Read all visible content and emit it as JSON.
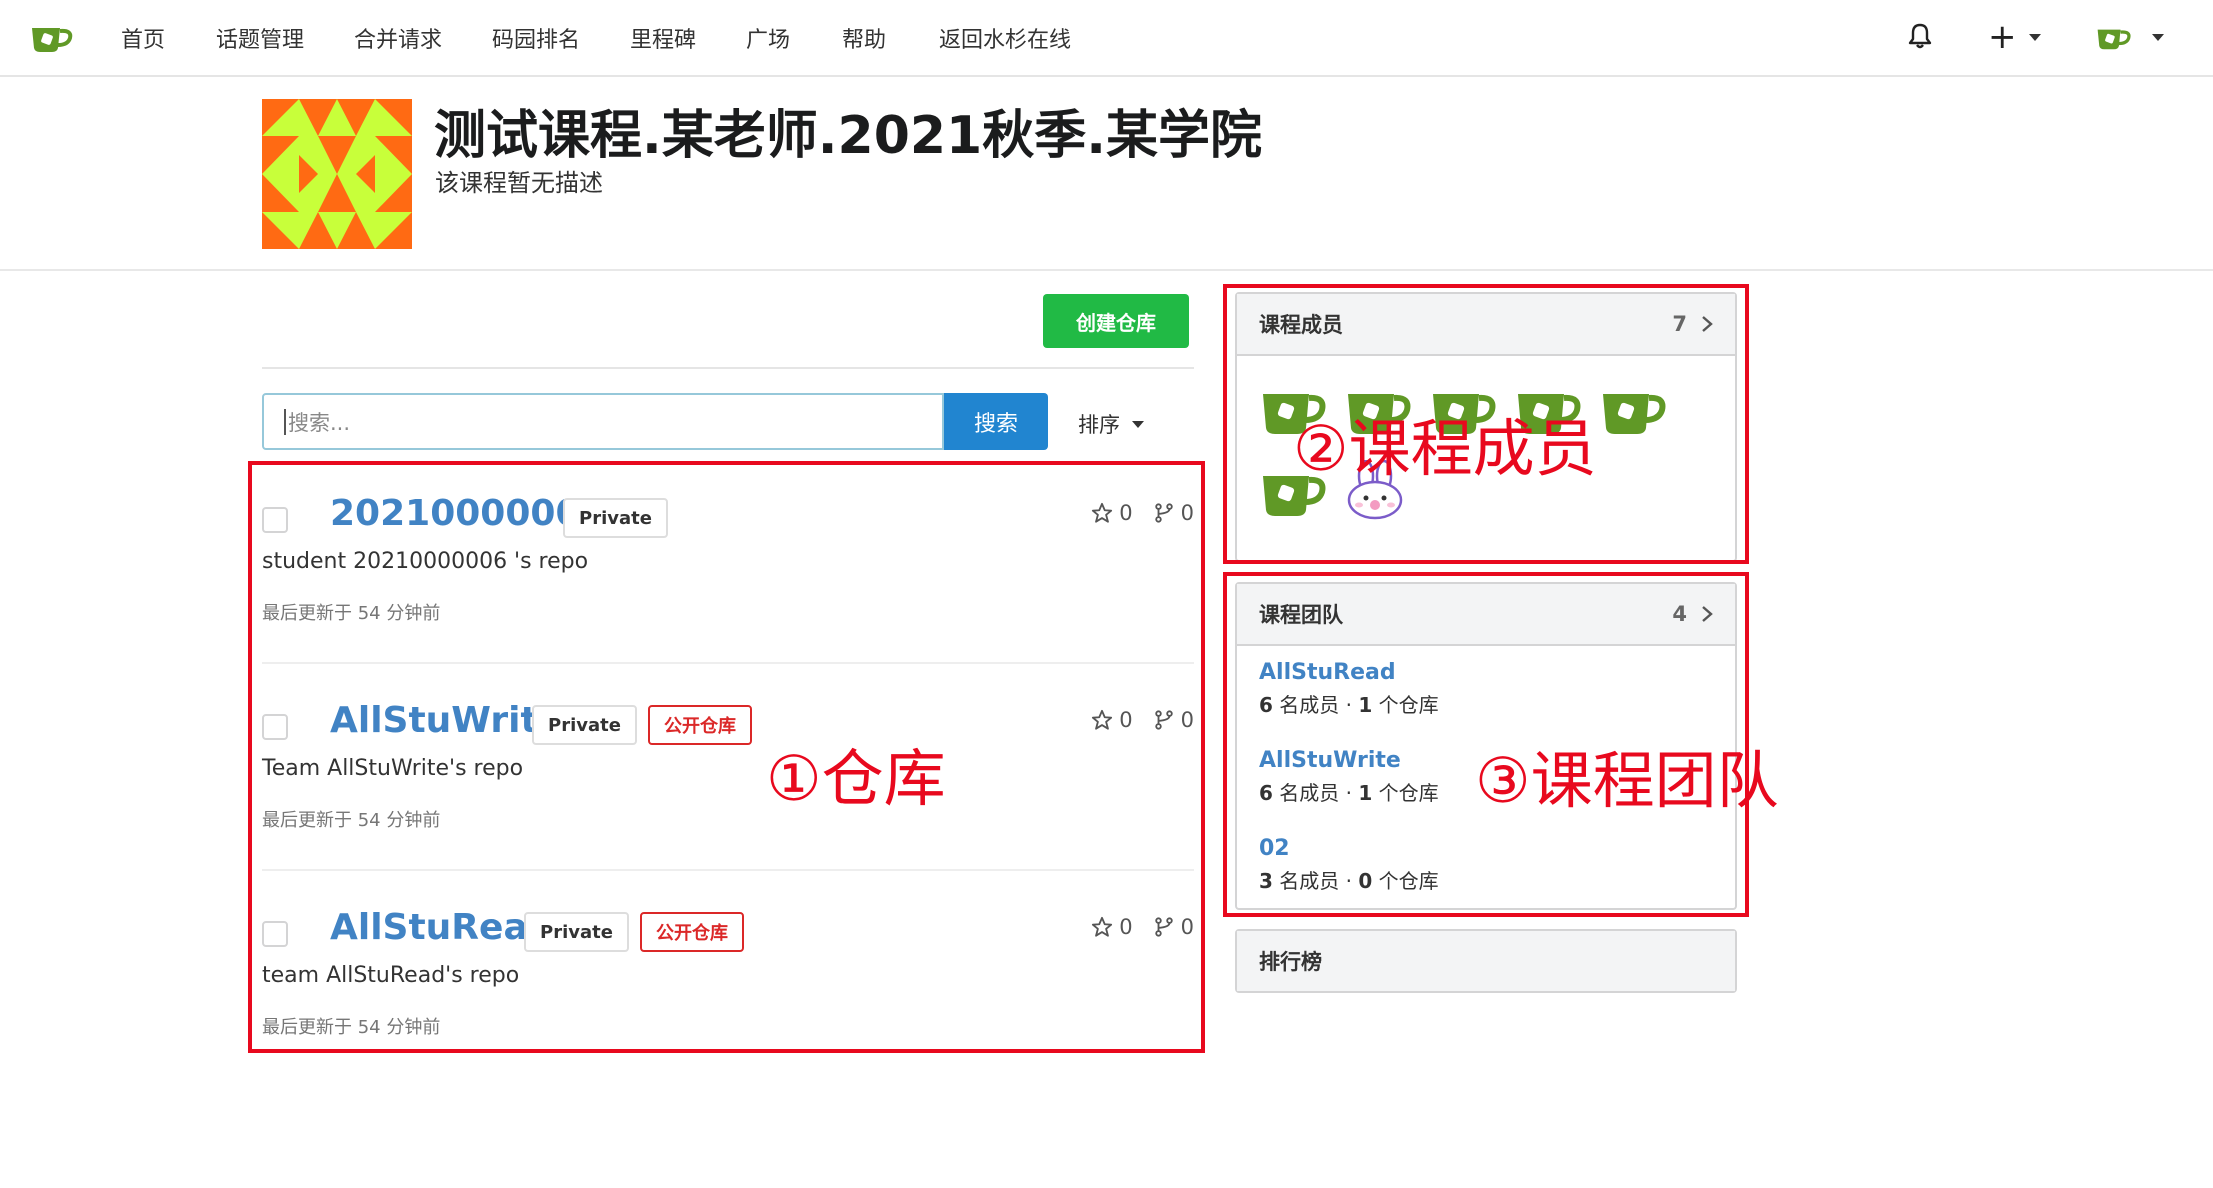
{
  "nav": {
    "items": [
      "首页",
      "话题管理",
      "合并请求",
      "码园排名",
      "里程碑",
      "广场",
      "帮助",
      "返回水杉在线"
    ],
    "plus_label": "+"
  },
  "header": {
    "title": "测试课程.某老师.2021秋季.某学院",
    "description": "该课程暂无描述"
  },
  "toolbar": {
    "create_repo": "创建仓库",
    "search_placeholder": "搜索...",
    "search_button": "搜索",
    "sort_label": "排序"
  },
  "repos": [
    {
      "name": "20210000006",
      "private_badge": "Private",
      "public_badge": "",
      "description": "student 20210000006 's repo",
      "updated": "最后更新于 54 分钟前",
      "stars": "0",
      "forks": "0"
    },
    {
      "name": "AllStuWrite",
      "private_badge": "Private",
      "public_badge": "公开仓库",
      "description": "Team AllStuWrite's repo",
      "updated": "最后更新于 54 分钟前",
      "stars": "0",
      "forks": "0"
    },
    {
      "name": "AllStuRead",
      "private_badge": "Private",
      "public_badge": "公开仓库",
      "description": "team AllStuRead's repo",
      "updated": "最后更新于 54 分钟前",
      "stars": "0",
      "forks": "0"
    }
  ],
  "members_panel": {
    "title": "课程成员",
    "count": "7",
    "avatar_icons": [
      "teacup-avatar",
      "teacup-avatar",
      "teacup-avatar",
      "teacup-avatar",
      "teacup-avatar",
      "teacup-avatar",
      "bunny-avatar"
    ]
  },
  "teams_panel": {
    "title": "课程团队",
    "count": "4",
    "teams": [
      {
        "name": "AllStuRead",
        "members": "6",
        "members_suffix": " 名成员 · ",
        "repos": "1",
        "repos_suffix": " 个仓库"
      },
      {
        "name": "AllStuWrite",
        "members": "6",
        "members_suffix": " 名成员 · ",
        "repos": "1",
        "repos_suffix": " 个仓库"
      },
      {
        "name": "02",
        "members": "3",
        "members_suffix": " 名成员 · ",
        "repos": "0",
        "repos_suffix": " 个仓库"
      }
    ]
  },
  "ranking_panel": {
    "title": "排行榜"
  },
  "annotations": {
    "repos": "①仓库",
    "members": "②课程成员",
    "teams": "③课程团队"
  },
  "colors": {
    "brand_green": "#609926",
    "link_blue": "#4183c4",
    "create_green": "#21ba45",
    "search_blue": "#2185d0",
    "annotation_red": "#e8091e"
  }
}
